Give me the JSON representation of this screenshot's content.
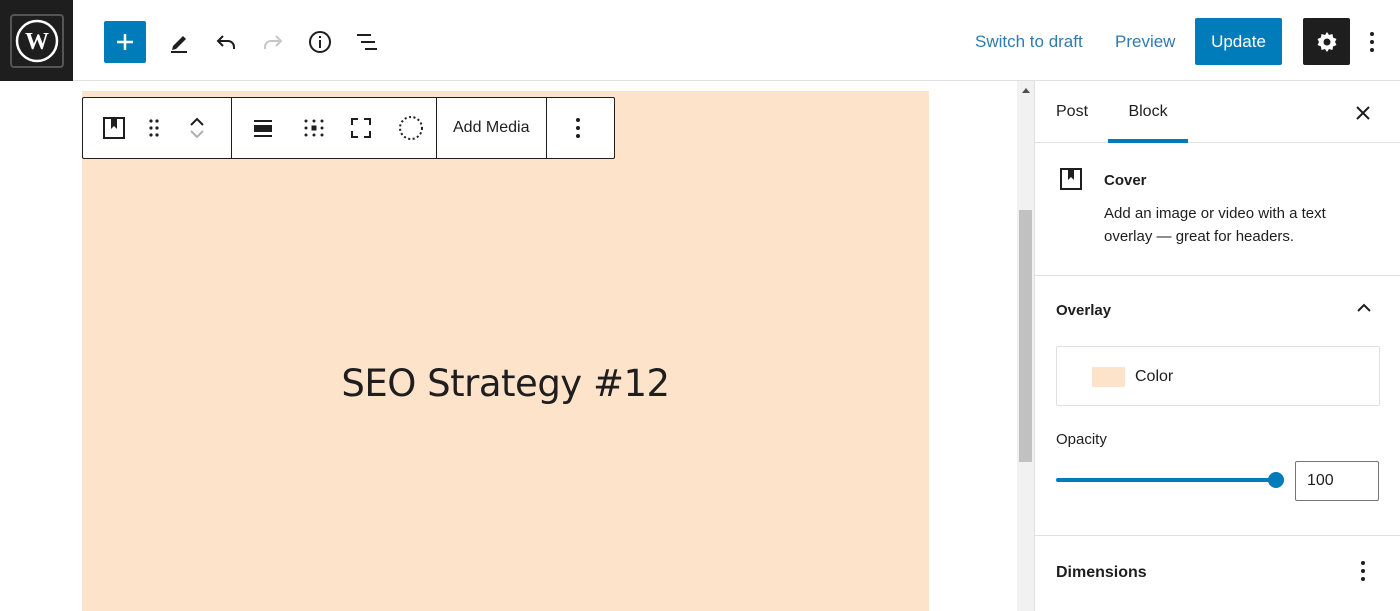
{
  "topbar": {
    "logo_icon": "wordpress-logo",
    "add_icon": "plus-icon",
    "tools_icon": "pencil-icon",
    "undo_icon": "undo-icon",
    "redo_icon": "redo-icon",
    "details_icon": "info-icon",
    "outline_icon": "list-view-icon",
    "switch_to_draft": "Switch to draft",
    "preview": "Preview",
    "update": "Update",
    "settings_icon": "gear-icon",
    "more_icon": "more-vertical-icon"
  },
  "block_toolbar": {
    "block_type_icon": "cover-block-icon",
    "drag_icon": "drag-handle-icon",
    "move_up_icon": "chevron-up-icon",
    "move_down_icon": "chevron-down-icon",
    "align_icon": "align-icon",
    "content_position_icon": "content-position-icon",
    "full_height_icon": "full-height-icon",
    "duotone_icon": "duotone-icon",
    "add_media": "Add Media",
    "options_icon": "more-vertical-icon"
  },
  "cover": {
    "title": "SEO Strategy #12",
    "color": "#fde3ca"
  },
  "sidebar": {
    "tabs": [
      {
        "label": "Post"
      },
      {
        "label": "Block"
      }
    ],
    "active_tab": "Block",
    "close_icon": "close-icon",
    "block_card": {
      "icon": "cover-block-icon",
      "title": "Cover",
      "description": "Add an image or video with a text overlay — great for headers."
    },
    "overlay": {
      "title": "Overlay",
      "chevron": "chevron-up-icon",
      "color_label": "Color",
      "color_value": "#fde3ca",
      "opacity_label": "Opacity",
      "opacity_value": "100"
    },
    "dimensions": {
      "title": "Dimensions",
      "more_icon": "more-vertical-icon"
    }
  },
  "colors": {
    "accent": "#007cba",
    "dark": "#1e1e1e",
    "link": "#2f7bb0"
  }
}
